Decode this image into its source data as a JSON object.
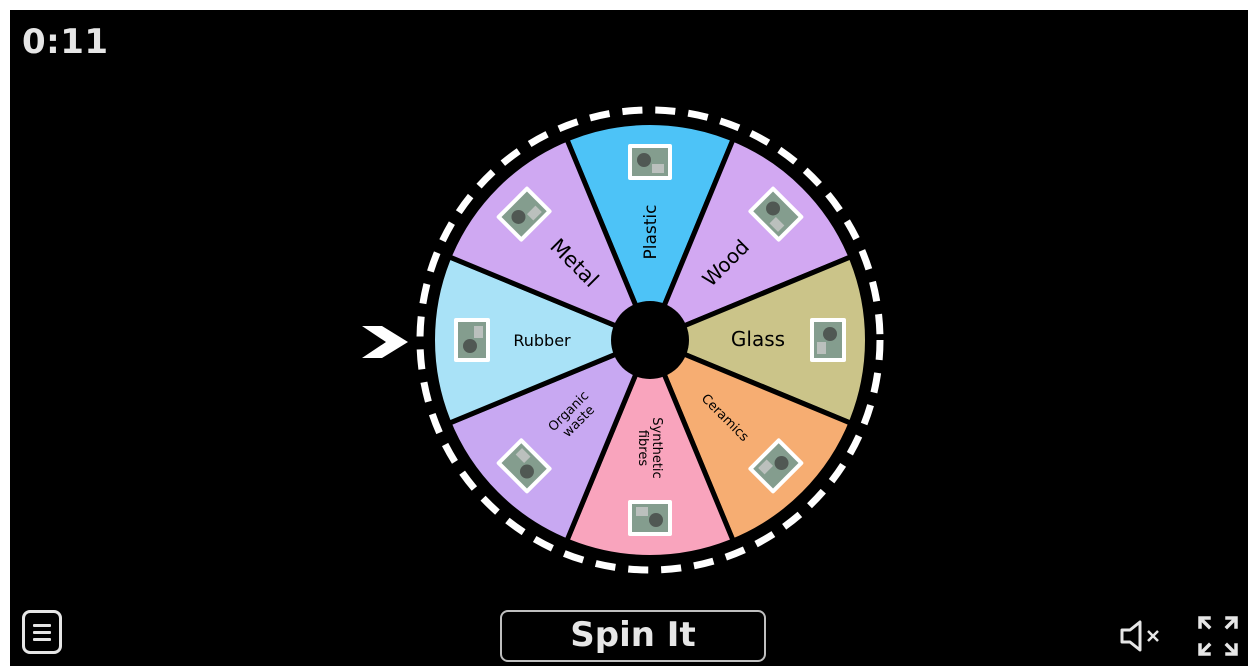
{
  "timer": "0:11",
  "spin_button": "Spin It",
  "colors": {
    "background": "#000000",
    "foreground": "#e6e6e6",
    "wheel_rim": "#ffffff",
    "hub": "#000000"
  },
  "icons": {
    "pointer": "chevron-right-icon",
    "menu": "hamburger-menu-icon",
    "sound": "speaker-muted-icon",
    "fullscreen": "fullscreen-icon"
  },
  "wheel": {
    "segments": [
      {
        "label": "Plastic",
        "color": "#4dc3f7",
        "image": "plastic-bottles-image"
      },
      {
        "label": "Wood",
        "color": "#d2a8f2",
        "image": "wood-chips-image"
      },
      {
        "label": "Glass",
        "color": "#cbc489",
        "image": "glass-jar-image"
      },
      {
        "label": "Ceramics",
        "color": "#f6ad72",
        "image": "ceramic-tiles-image"
      },
      {
        "label": "Synthetic fibres",
        "color": "#f9a4bd",
        "image": "fabric-rolls-image"
      },
      {
        "label": "Organic waste",
        "color": "#c8a8f2",
        "image": "food-scraps-image"
      },
      {
        "label": "Rubber",
        "color": "#a9e2f7",
        "image": "tyre-image"
      },
      {
        "label": "Metal",
        "color": "#cfa8f2",
        "image": "metal-coils-image"
      }
    ]
  }
}
